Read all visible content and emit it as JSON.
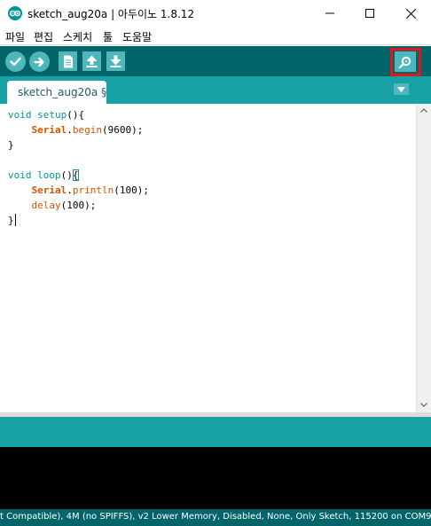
{
  "window": {
    "title": "sketch_aug20a | 아두이노 1.8.12"
  },
  "menu": {
    "items": [
      "파일",
      "편집",
      "스케치",
      "툴",
      "도움말"
    ]
  },
  "toolbar": {
    "buttons": [
      {
        "name": "verify",
        "icon": "checkmark-icon"
      },
      {
        "name": "upload",
        "icon": "right-arrow-icon"
      },
      {
        "name": "new",
        "icon": "document-icon"
      },
      {
        "name": "open",
        "icon": "up-arrow-icon"
      },
      {
        "name": "save",
        "icon": "down-arrow-icon"
      }
    ],
    "serial_monitor_icon": "magnifier-icon",
    "highlight_color": "#e8141b"
  },
  "tabs": [
    {
      "label": "sketch_aug20a §"
    }
  ],
  "editor": {
    "lines": [
      [
        "void",
        " ",
        "setup",
        "(){"
      ],
      [
        "    ",
        "Serial",
        ".",
        "begin",
        "(9600);"
      ],
      [
        "}"
      ],
      [
        ""
      ],
      [
        "void",
        " ",
        "loop",
        "()",
        "{"
      ],
      [
        "    ",
        "Serial",
        ".",
        "println",
        "(100);"
      ],
      [
        "    ",
        "delay",
        "(100);"
      ],
      [
        "}"
      ]
    ]
  },
  "status": {
    "text": "t Compatible), 4M (no SPIFFS), v2 Lower Memory, Disabled, None, Only Sketch, 115200 on COM9"
  },
  "colors": {
    "toolbar_bg": "#006468",
    "tab_bar_bg": "#17a1a5",
    "button_bg": "#4db7bb",
    "keyword": "#00979c",
    "function": "#d35400"
  }
}
